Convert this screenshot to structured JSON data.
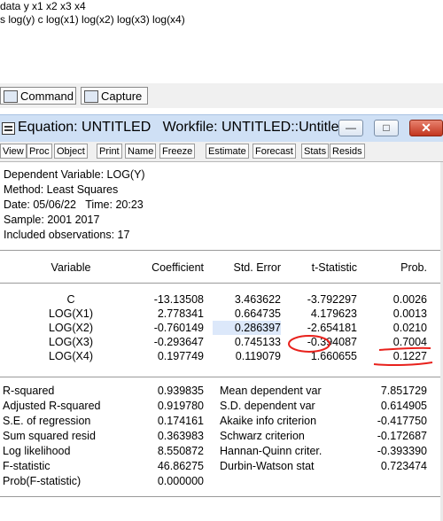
{
  "command_lines": [
    "data y x1 x2 x3 x4",
    "s log(y) c log(x1) log(x2) log(x3) log(x4)"
  ],
  "main_tabs": [
    {
      "label": "Command",
      "icon": "command-window-icon"
    },
    {
      "label": "Capture",
      "icon": "capture-window-icon"
    }
  ],
  "window": {
    "title": "Equation: UNTITLED   Workfile: UNTITLED::Untitled\\",
    "buttons": {
      "minimize": "—",
      "maximize": "□",
      "close": "✕"
    }
  },
  "toolbar": [
    "View",
    "Proc",
    "Object",
    "Print",
    "Name",
    "Freeze",
    "Estimate",
    "Forecast",
    "Stats",
    "Resids"
  ],
  "header": {
    "dependent": "Dependent Variable: LOG(Y)",
    "method": "Method: Least Squares",
    "date": "Date: 05/06/22   Time: 20:23",
    "sample": "Sample: 2001 2017",
    "obs": "Included observations: 17"
  },
  "table": {
    "columns": [
      "Variable",
      "Coefficient",
      "Std. Error",
      "t-Statistic",
      "Prob."
    ],
    "rows": [
      [
        "C",
        "-13.13508",
        "3.463622",
        "-3.792297",
        "0.0026"
      ],
      [
        "LOG(X1)",
        "2.778341",
        "0.664735",
        "4.179623",
        "0.0013"
      ],
      [
        "LOG(X2)",
        "-0.760149",
        "0.286397",
        "-2.654181",
        "0.0210"
      ],
      [
        "LOG(X3)",
        "-0.293647",
        "0.745133",
        "-0.394087",
        "0.7004"
      ],
      [
        "LOG(X4)",
        "0.197749",
        "0.119079",
        "1.660655",
        "0.1227"
      ]
    ]
  },
  "stats": [
    [
      "R-squared",
      "0.939835",
      "Mean dependent var",
      "7.851729"
    ],
    [
      "Adjusted R-squared",
      "0.919780",
      "S.D. dependent var",
      "0.614905"
    ],
    [
      "S.E. of regression",
      "0.174161",
      "Akaike info criterion",
      "-0.417750"
    ],
    [
      "Sum squared resid",
      "0.363983",
      "Schwarz criterion",
      "-0.172687"
    ],
    [
      "Log likelihood",
      "8.550872",
      "Hannan-Quinn criter.",
      "-0.393390"
    ],
    [
      "F-statistic",
      "46.86275",
      "Durbin-Watson stat",
      "0.723474"
    ],
    [
      "Prob(F-statistic)",
      "0.000000",
      "",
      ""
    ]
  ],
  "annotation_color": "#e8211c",
  "highlight_color": "#dce8fa"
}
